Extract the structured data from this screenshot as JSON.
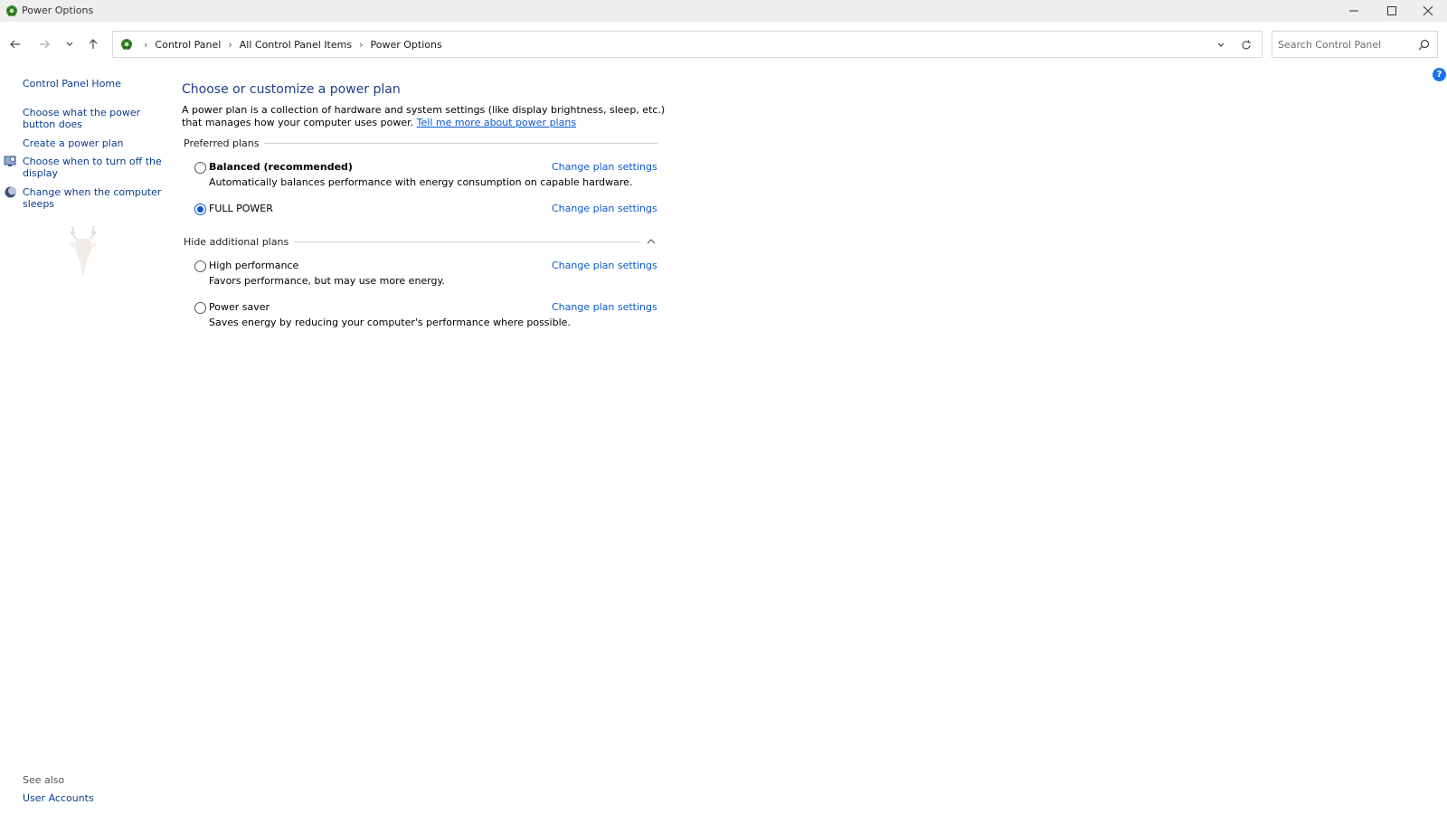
{
  "window": {
    "title": "Power Options"
  },
  "address_bar": {
    "crumbs": [
      "Control Panel",
      "All Control Panel Items",
      "Power Options"
    ]
  },
  "search": {
    "placeholder": "Search Control Panel"
  },
  "help": {
    "label": "?"
  },
  "sidebar": {
    "home": "Control Panel Home",
    "items": [
      "Choose what the power button does",
      "Create a power plan",
      "Choose when to turn off the display",
      "Change when the computer sleeps"
    ],
    "see_also": "See also",
    "user_accounts": "User Accounts"
  },
  "main": {
    "title": "Choose or customize a power plan",
    "description": "A power plan is a collection of hardware and system settings (like display brightness, sleep, etc.) that manages how your computer uses power.",
    "learn_more": "Tell me more about power plans",
    "preferred_heading": "Preferred plans",
    "additional_heading": "Hide additional plans",
    "change_label": "Change plan settings",
    "plans": [
      {
        "name": "Balanced (recommended)",
        "description": "Automatically balances performance with energy consumption on capable hardware.",
        "selected": false
      },
      {
        "name": "FULL POWER",
        "description": "",
        "selected": true
      },
      {
        "name": "High performance",
        "description": "Favors performance, but may use more energy.",
        "selected": false
      },
      {
        "name": "Power saver",
        "description": "Saves energy by reducing your computer's performance where possible.",
        "selected": false
      }
    ]
  },
  "colors": {
    "link": "#0b57d0",
    "title": "#1e3e8c",
    "titlebar": "#eeeeee"
  }
}
